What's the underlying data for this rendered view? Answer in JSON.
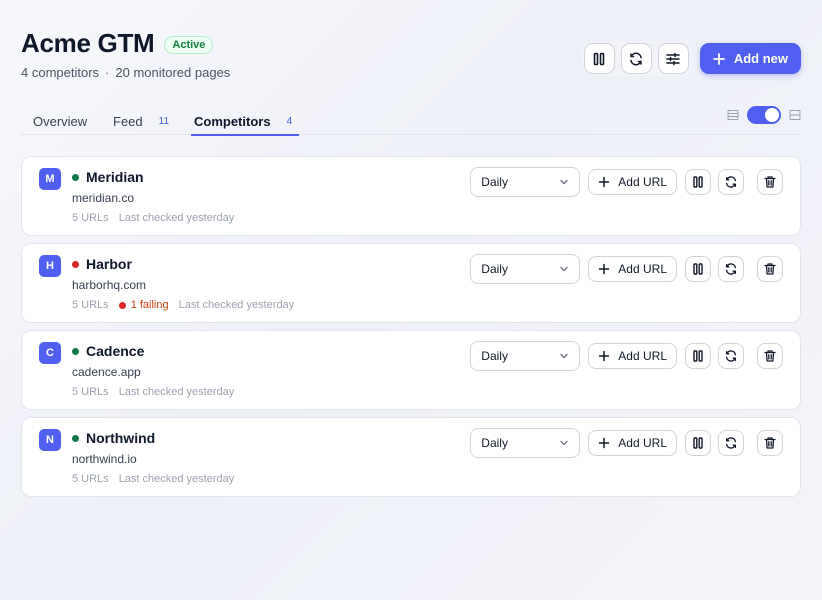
{
  "header": {
    "title": "Acme GTM",
    "status": "Active",
    "competitors_count": "4 competitors",
    "separator": "·",
    "pages_count": "20 monitored pages"
  },
  "toolbar": {
    "add_new_label": "Add new",
    "icons": [
      "pause-icon",
      "refresh-icon",
      "sliders-icon",
      "plus-icon"
    ]
  },
  "tabs": [
    {
      "label": "Overview",
      "count": ""
    },
    {
      "label": "Feed",
      "count": "11"
    },
    {
      "label": "Competitors",
      "count": "4",
      "active": true
    }
  ],
  "view_toggle": {
    "on": true
  },
  "colors": {
    "accent": "#4f5ff0",
    "active_status": "#0f7a4a",
    "failing_status": "#dc2626"
  },
  "competitors": [
    {
      "initial": "M",
      "name": "Meridian",
      "domain": "meridian.co",
      "urls": "5 URLs",
      "failing": "",
      "last_checked": "Last checked yesterday",
      "status": "active",
      "frequency": "Daily",
      "add_url_label": "Add URL"
    },
    {
      "initial": "H",
      "name": "Harbor",
      "domain": "harborhq.com",
      "urls": "5 URLs",
      "failing": "1 failing",
      "last_checked": "Last checked yesterday",
      "status": "failing",
      "frequency": "Daily",
      "add_url_label": "Add URL"
    },
    {
      "initial": "C",
      "name": "Cadence",
      "domain": "cadence.app",
      "urls": "5 URLs",
      "failing": "",
      "last_checked": "Last checked yesterday",
      "status": "active",
      "frequency": "Daily",
      "add_url_label": "Add URL"
    },
    {
      "initial": "N",
      "name": "Northwind",
      "domain": "northwind.io",
      "urls": "5 URLs",
      "failing": "",
      "last_checked": "Last checked yesterday",
      "status": "active",
      "frequency": "Daily",
      "add_url_label": "Add URL"
    }
  ]
}
